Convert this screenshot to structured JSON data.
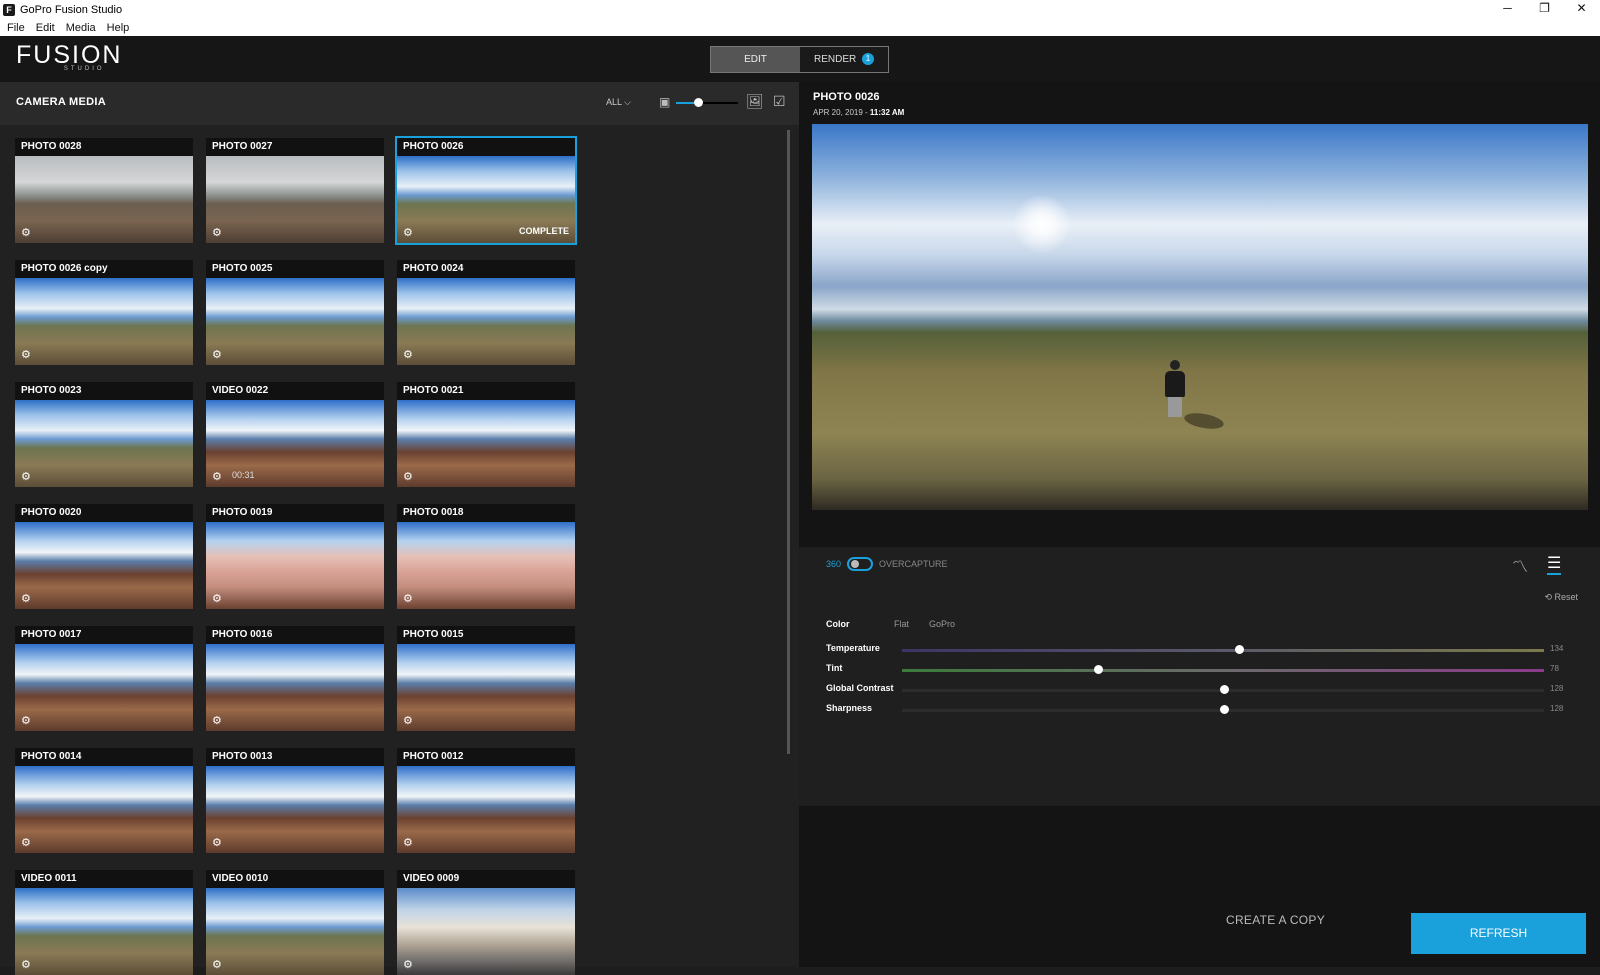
{
  "window": {
    "title": "GoPro Fusion Studio",
    "menu": [
      "File",
      "Edit",
      "Media",
      "Help"
    ],
    "controls": [
      "─",
      "❐",
      "✕"
    ]
  },
  "header": {
    "logo": "FUSION",
    "logo_sub": "STUDIO",
    "tabs": {
      "edit": "EDIT",
      "render": "RENDER",
      "render_badge": "1"
    }
  },
  "media": {
    "heading": "CAMERA MEDIA",
    "filter": "ALL ⌵",
    "zoom_level": 0.35,
    "items": [
      {
        "label": "PHOTO 0028",
        "style": "cloudy"
      },
      {
        "label": "PHOTO 0027",
        "style": "cloudy"
      },
      {
        "label": "PHOTO 0026",
        "style": "bright",
        "status": "COMPLETE",
        "selected": true
      },
      {
        "label": "PHOTO 0026 copy",
        "style": "bright"
      },
      {
        "label": "PHOTO 0025",
        "style": "bright"
      },
      {
        "label": "PHOTO 0024",
        "style": "bright"
      },
      {
        "label": "PHOTO 0023",
        "style": "bright"
      },
      {
        "label": "VIDEO 0022",
        "style": "beach",
        "duration": "00:31"
      },
      {
        "label": "PHOTO 0021",
        "style": "beach"
      },
      {
        "label": "PHOTO 0020",
        "style": "beach"
      },
      {
        "label": "PHOTO 0019",
        "style": "pink"
      },
      {
        "label": "PHOTO 0018",
        "style": "pink"
      },
      {
        "label": "PHOTO 0017",
        "style": "beach"
      },
      {
        "label": "PHOTO 0016",
        "style": "beach"
      },
      {
        "label": "PHOTO 0015",
        "style": "beach"
      },
      {
        "label": "PHOTO 0014",
        "style": "beach"
      },
      {
        "label": "PHOTO 0013",
        "style": "beach"
      },
      {
        "label": "PHOTO 0012",
        "style": "beach"
      },
      {
        "label": "VIDEO 0011",
        "style": "bright"
      },
      {
        "label": "VIDEO 0010",
        "style": "bright"
      },
      {
        "label": "VIDEO 0009",
        "style": "city"
      }
    ]
  },
  "preview": {
    "title": "PHOTO 0026",
    "date": "APR 20, 2019 - ",
    "time": "11:32 AM"
  },
  "controls": {
    "mode_360": "360",
    "mode_overcapture": "OVERCAPTURE",
    "reset": "⟲ Reset",
    "color_label": "Color",
    "color_options": [
      "Flat",
      "GoPro"
    ],
    "sliders": [
      {
        "name": "Temperature",
        "value": "134",
        "position": 0.525
      },
      {
        "name": "Tint",
        "value": "78",
        "position": 0.306
      },
      {
        "name": "Global Contrast",
        "value": "128",
        "position": 0.502
      },
      {
        "name": "Sharpness",
        "value": "128",
        "position": 0.502
      }
    ]
  },
  "actions": {
    "create_copy": "CREATE A COPY",
    "refresh": "REFRESH"
  },
  "colors": {
    "accent": "#1aa0db",
    "panel": "#212121",
    "background": "#141414"
  }
}
